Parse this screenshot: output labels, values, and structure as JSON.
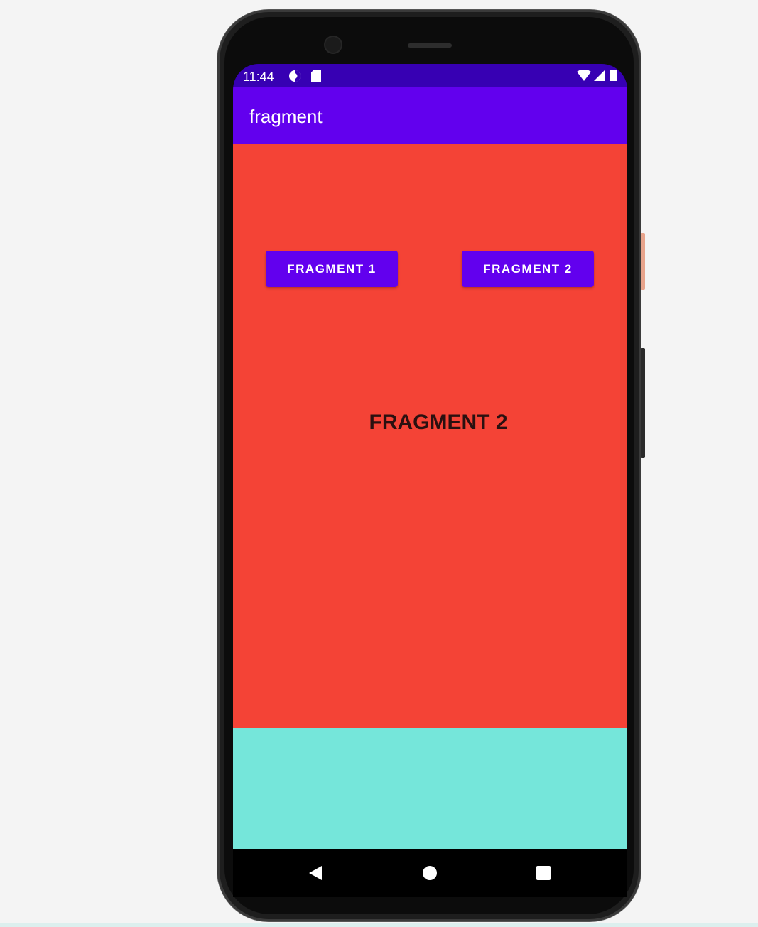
{
  "status_bar": {
    "time": "11:44",
    "icons": [
      "data-saver-icon",
      "sd-card-icon",
      "wifi-icon",
      "signal-icon",
      "battery-icon"
    ]
  },
  "app_bar": {
    "title": "fragment"
  },
  "main": {
    "button_1_label": "FRAGMENT 1",
    "button_2_label": "FRAGMENT 2",
    "fragment_text": "FRAGMENT 2"
  },
  "nav_bar": {
    "icons": [
      "back-icon",
      "home-icon",
      "recents-icon"
    ]
  },
  "colors": {
    "status_bar": "#3700b3",
    "app_bar": "#6200ee",
    "fragment_background": "#f44336",
    "bottom_pane": "#75e6da",
    "button": "#6200ee"
  }
}
